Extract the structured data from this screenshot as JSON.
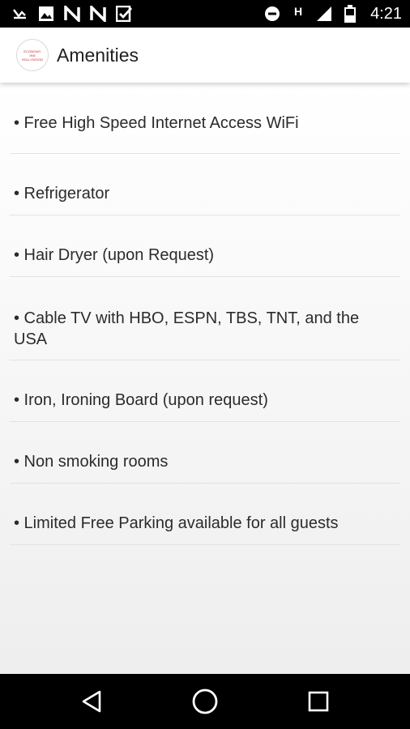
{
  "status_bar": {
    "time": "4:21",
    "network_label": "H"
  },
  "app_bar": {
    "title": "Amenities",
    "logo_lines": [
      "ECONOMY",
      "INN",
      "HOLLYWOOD"
    ]
  },
  "amenities": [
    "• Free High Speed Internet Access WiFi",
    "• Refrigerator",
    "• Hair Dryer (upon Request)",
    "• Cable TV with HBO, ESPN, TBS, TNT, and the USA",
    "• Iron, Ironing Board (upon request)",
    "• Non smoking rooms",
    "• Limited Free Parking available for all guests"
  ],
  "colors": {
    "logo_accent": "#c0262d",
    "text": "#2b2b2b"
  }
}
